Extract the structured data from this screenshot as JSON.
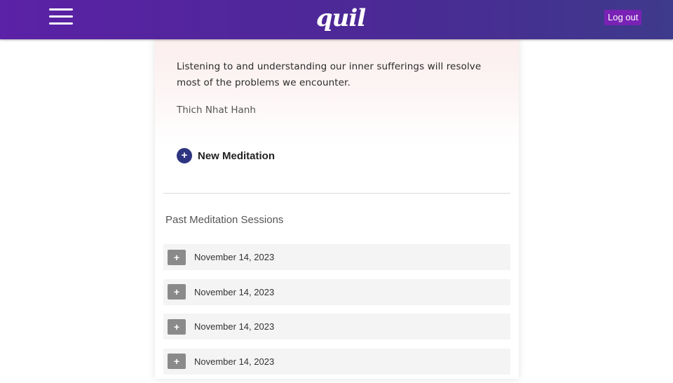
{
  "header": {
    "logo_text": "quil",
    "logout_label": "Log out",
    "menu_icon": "hamburger-menu-icon",
    "brand_gradient": [
      "#5b21a6",
      "#3e3a8c"
    ]
  },
  "quote": {
    "text": "Listening to and understanding our inner sufferings will resolve most of the problems we encounter.",
    "author": "Thich Nhat Hanh"
  },
  "new_meditation": {
    "icon": "plus-icon",
    "label": "New Meditation"
  },
  "past_sessions": {
    "title": "Past Meditation Sessions",
    "expand_icon": "+",
    "items": [
      {
        "date": "November 14, 2023"
      },
      {
        "date": "November 14, 2023"
      },
      {
        "date": "November 14, 2023"
      },
      {
        "date": "November 14, 2023"
      }
    ]
  }
}
